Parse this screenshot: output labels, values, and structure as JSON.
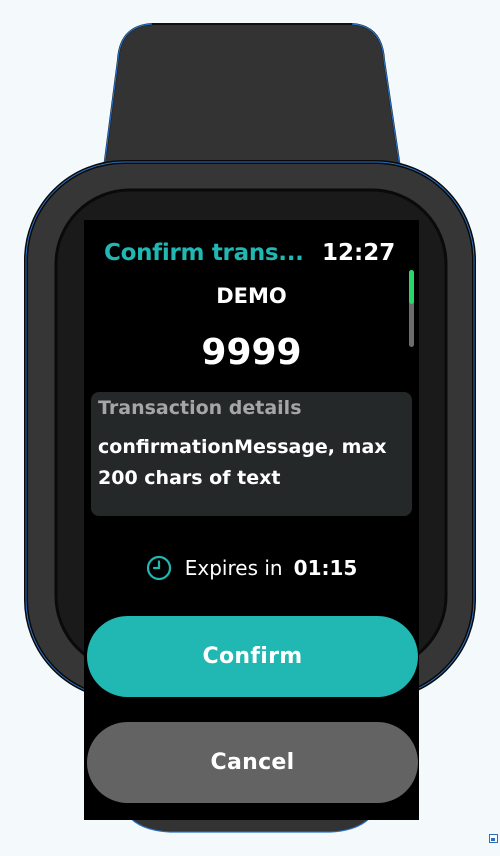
{
  "header": {
    "title": "Confirm trans...",
    "time": "12:27"
  },
  "transaction": {
    "merchant": "DEMO",
    "amount": "9999",
    "details_label": "Transaction details",
    "details_text": "confirmationMessage, max 200 chars of text"
  },
  "expiry": {
    "icon": "clock-icon",
    "label": "Expires in",
    "value": "01:15"
  },
  "buttons": {
    "confirm_label": "Confirm",
    "cancel_label": "Cancel"
  },
  "scroll": {
    "position_fraction": 0
  },
  "colors": {
    "accent": "#21b8b4",
    "scroll_thumb": "#2ad66a",
    "card_bg": "#252828",
    "cancel_bg": "#636363",
    "watch_body": "#333333"
  }
}
